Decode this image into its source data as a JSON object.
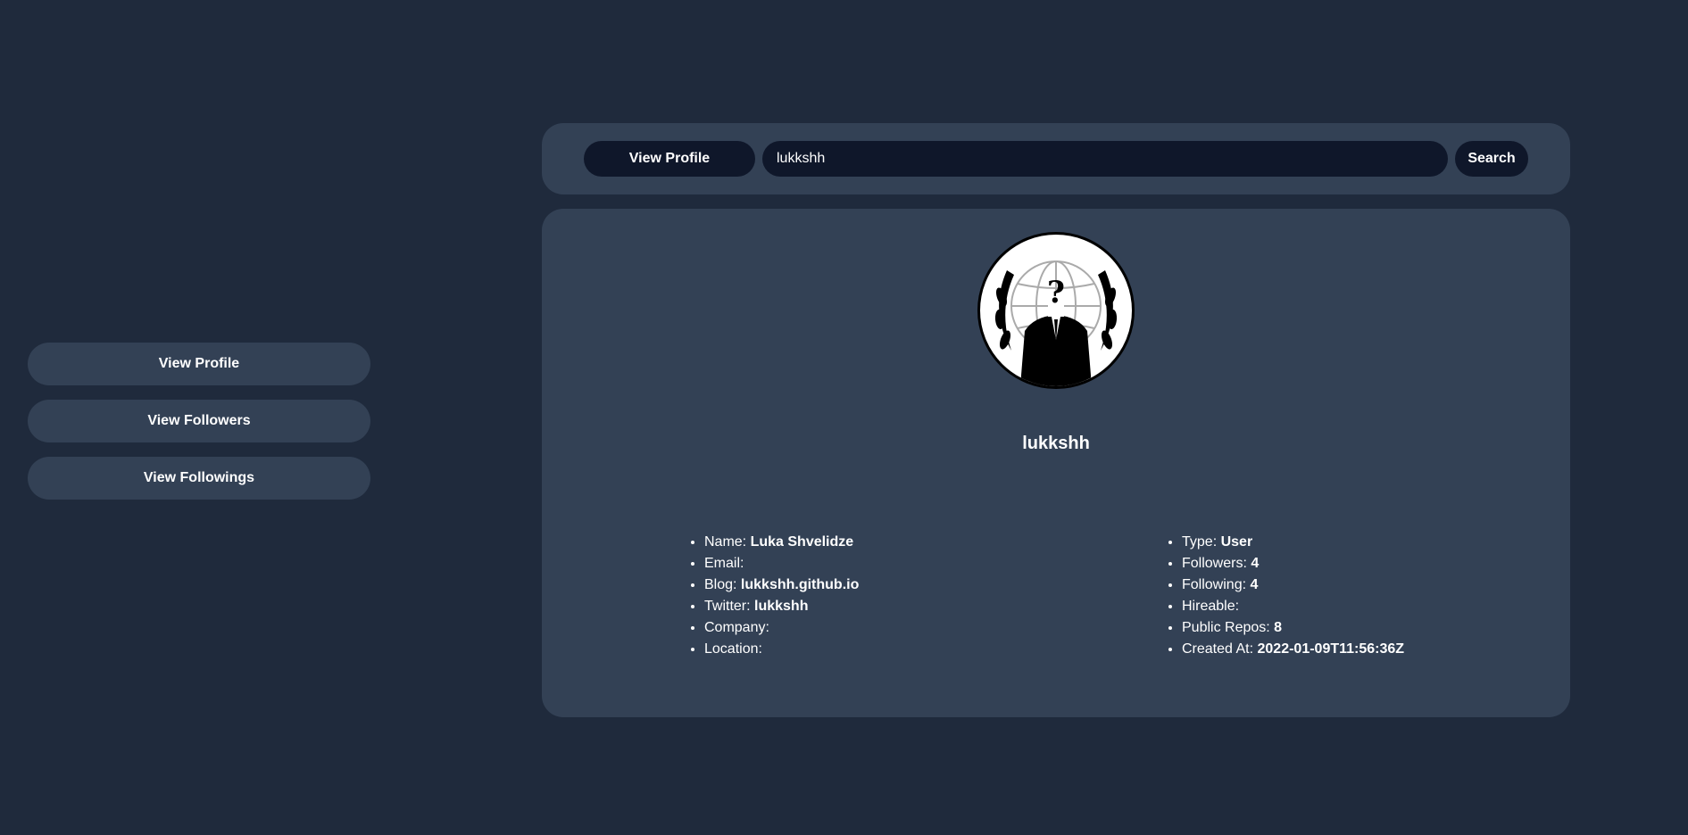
{
  "sidebar": {
    "items": [
      {
        "label": "View Profile"
      },
      {
        "label": "View Followers"
      },
      {
        "label": "View Followings"
      }
    ]
  },
  "search": {
    "mode_label": "View Profile",
    "value": "lukkshh",
    "button_label": "Search"
  },
  "profile": {
    "avatar_icon": "anonymous-mask-icon",
    "username": "lukkshh",
    "left": [
      {
        "label": "Name:",
        "value": "Luka Shvelidze"
      },
      {
        "label": "Email:",
        "value": ""
      },
      {
        "label": "Blog:",
        "value": "lukkshh.github.io"
      },
      {
        "label": "Twitter:",
        "value": "lukkshh"
      },
      {
        "label": "Company:",
        "value": ""
      },
      {
        "label": "Location:",
        "value": ""
      }
    ],
    "right": [
      {
        "label": "Type:",
        "value": "User"
      },
      {
        "label": "Followers:",
        "value": "4"
      },
      {
        "label": "Following:",
        "value": "4"
      },
      {
        "label": "Hireable:",
        "value": ""
      },
      {
        "label": "Public Repos:",
        "value": "8"
      },
      {
        "label": "Created At:",
        "value": "2022-01-09T11:56:36Z"
      }
    ]
  },
  "colors": {
    "background": "#1f2a3c",
    "panel": "#334155",
    "control": "#0f172a",
    "text": "#ffffff"
  }
}
